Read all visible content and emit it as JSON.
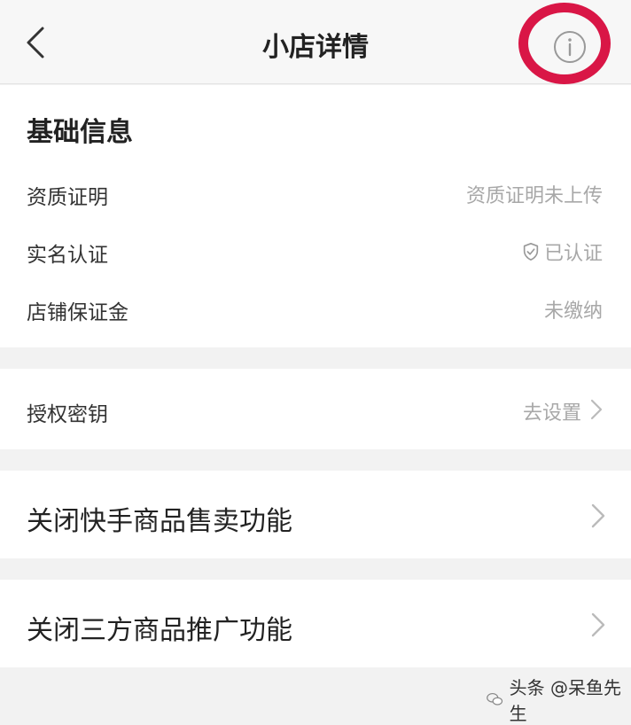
{
  "header": {
    "title": "小店详情",
    "back_icon": "chevron-left-icon",
    "info_icon": "info-icon",
    "highlight_color": "#d91646"
  },
  "basic_info": {
    "title": "基础信息",
    "rows": [
      {
        "label": "资质证明",
        "value": "资质证明未上传"
      },
      {
        "label": "实名认证",
        "value": "已认证",
        "icon": "shield-check-icon"
      },
      {
        "label": "店铺保证金",
        "value": "未缴纳"
      }
    ]
  },
  "auth_key": {
    "label": "授权密钥",
    "value": "去设置"
  },
  "actions": [
    {
      "label": "关闭快手商品售卖功能"
    },
    {
      "label": "关闭三方商品推广功能"
    }
  ],
  "watermark": {
    "text": "头条 @呆鱼先生"
  }
}
